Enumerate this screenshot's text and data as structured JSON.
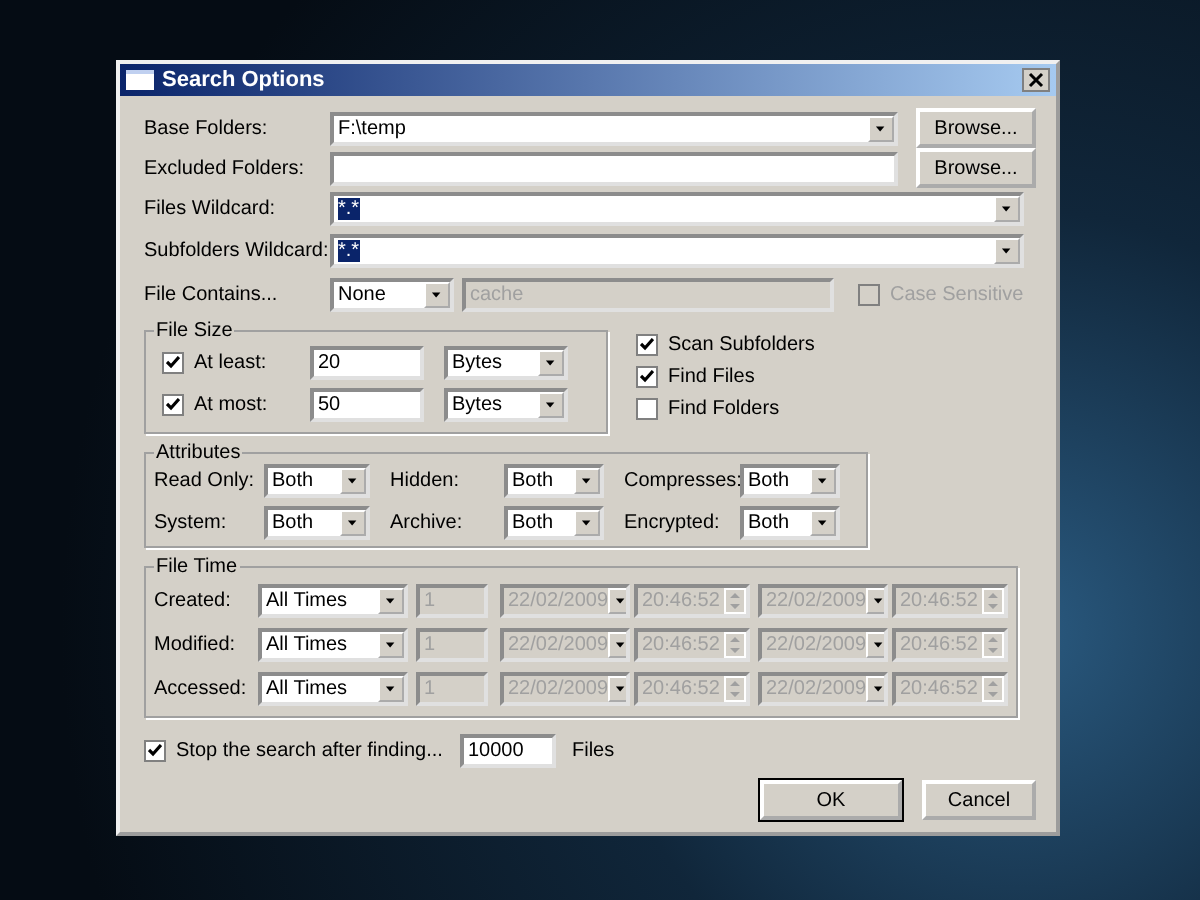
{
  "window": {
    "title": "Search Options"
  },
  "folders": [
    {
      "label": "Base Folders:",
      "kind": "combo",
      "value": "F:\\temp",
      "button": "Browse..."
    },
    {
      "label": "Excluded Folders:",
      "kind": "text",
      "button": "Browse..."
    }
  ],
  "wildcards": [
    {
      "label": "Files Wildcard:",
      "value": "*.*",
      "highlighted": true
    },
    {
      "label": "Subfolders Wildcard:",
      "value": "*.*",
      "highlighted": true
    }
  ],
  "file_contains": {
    "label": "File Contains...",
    "mode": "None",
    "text": "cache",
    "disabled": true,
    "case_sensitive": {
      "label": "Case Sensitive",
      "checked": false,
      "disabled": true
    }
  },
  "file_size": {
    "title": "File Size",
    "rows": [
      {
        "label": "At least:",
        "checked": true,
        "value": "20",
        "unit": "Bytes"
      },
      {
        "label": "At most:",
        "checked": true,
        "value": "50",
        "unit": "Bytes"
      }
    ]
  },
  "options": [
    {
      "label": "Scan Subfolders",
      "checked": true
    },
    {
      "label": "Find Files",
      "checked": true
    },
    {
      "label": "Find Folders",
      "checked": false
    }
  ],
  "attributes": {
    "title": "Attributes",
    "items": [
      {
        "label": "Read Only:",
        "value": "Both"
      },
      {
        "label": "Hidden:",
        "value": "Both"
      },
      {
        "label": "Compresses:",
        "value": "Both"
      },
      {
        "label": "System:",
        "value": "Both"
      },
      {
        "label": "Archive:",
        "value": "Both"
      },
      {
        "label": "Encrypted:",
        "value": "Both"
      }
    ]
  },
  "file_time": {
    "title": "File Time",
    "rows": [
      {
        "label": "Created:",
        "mode": "All Times",
        "count": "1",
        "from_date": "22/02/2009",
        "from_time": "20:46:52",
        "to_date": "22/02/2009",
        "to_time": "20:46:52",
        "disabled": true
      },
      {
        "label": "Modified:",
        "mode": "All Times",
        "count": "1",
        "from_date": "22/02/2009",
        "from_time": "20:46:52",
        "to_date": "22/02/2009",
        "to_time": "20:46:52",
        "disabled": true
      },
      {
        "label": "Accessed:",
        "mode": "All Times",
        "count": "1",
        "from_date": "22/02/2009",
        "from_time": "20:46:52",
        "to_date": "22/02/2009",
        "to_time": "20:46:52",
        "disabled": true
      }
    ]
  },
  "limit": {
    "label": "Stop the search after finding...",
    "checked": true,
    "value": "10000",
    "unit": "Files"
  },
  "buttons": [
    {
      "label": "OK",
      "default": true
    },
    {
      "label": "Cancel",
      "default": false
    }
  ]
}
